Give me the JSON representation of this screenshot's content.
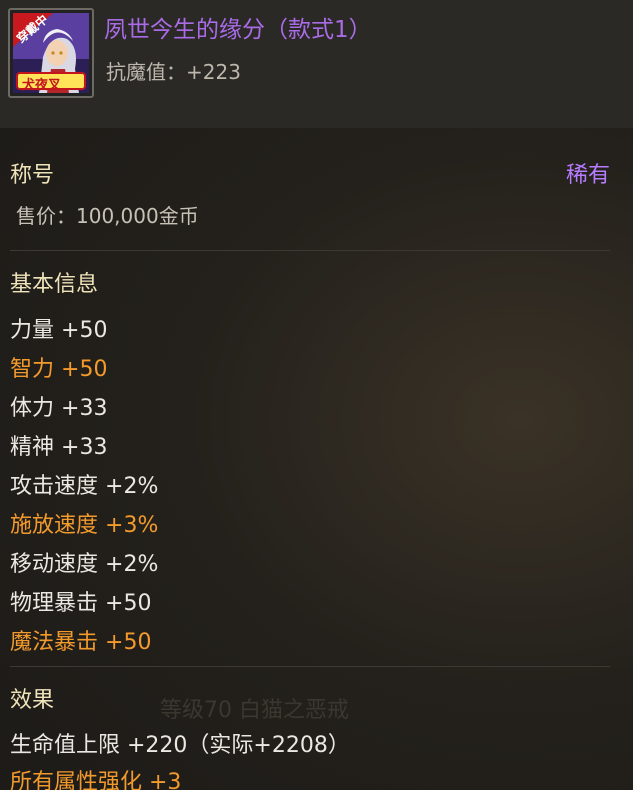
{
  "item": {
    "title": "夙世今生的缘分（款式1）",
    "attribute": "抗魔值：+223",
    "icon_badge": "穿戴中",
    "icon_logo": "犬夜叉"
  },
  "category": {
    "label": "称号",
    "rarity": "稀有",
    "price": "售价：100,000金币"
  },
  "basic_info": {
    "title": "基本信息",
    "stats": [
      {
        "name": "力量",
        "value": "+50",
        "color": "plain"
      },
      {
        "name": "智力",
        "value": "+50",
        "color": "orange"
      },
      {
        "name": "体力",
        "value": "+33",
        "color": "plain"
      },
      {
        "name": "精神",
        "value": "+33",
        "color": "plain"
      },
      {
        "name": "攻击速度",
        "value": "+2%",
        "color": "plain"
      },
      {
        "name": "施放速度",
        "value": "+3%",
        "color": "orange"
      },
      {
        "name": "移动速度",
        "value": "+2%",
        "color": "plain"
      },
      {
        "name": "物理暴击",
        "value": "+50",
        "color": "plain"
      },
      {
        "name": "魔法暴击",
        "value": "+50",
        "color": "orange"
      }
    ]
  },
  "effects": {
    "title": "效果",
    "lines": [
      {
        "text": "生命值上限 +220（实际+2208）",
        "color": "plain"
      },
      {
        "text": "所有属性强化 +3",
        "color": "orange"
      }
    ]
  },
  "background_text": "等级70 白猫之恶戒",
  "colors": {
    "title_purple": "#a96ce6",
    "rarity_purple": "#b77cff",
    "highlight_orange": "#f39a2c",
    "plain_text": "#ebe8e2"
  }
}
